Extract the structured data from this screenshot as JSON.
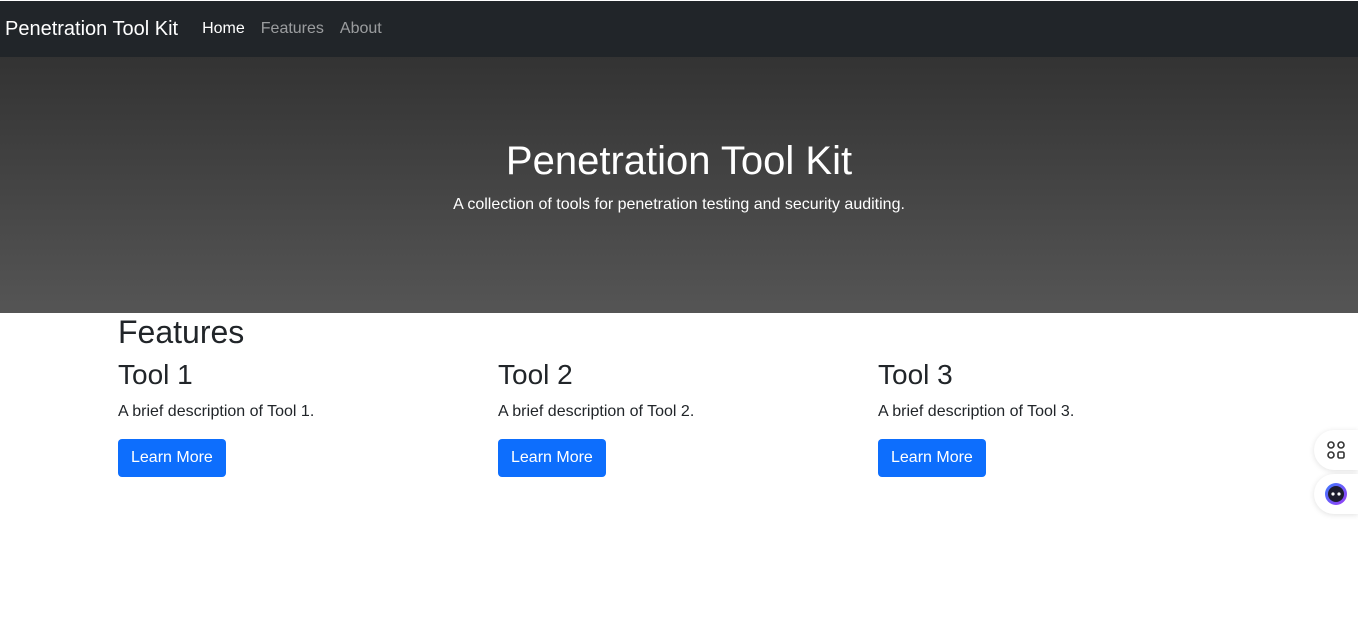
{
  "navbar": {
    "brand": "Penetration Tool Kit",
    "links": [
      {
        "label": "Home"
      },
      {
        "label": "Features"
      },
      {
        "label": "About"
      }
    ]
  },
  "hero": {
    "title": "Penetration Tool Kit",
    "subtitle": "A collection of tools for penetration testing and security auditing."
  },
  "features": {
    "title": "Features",
    "tools": [
      {
        "name": "Tool 1",
        "description": "A brief description of Tool 1.",
        "button": "Learn More"
      },
      {
        "name": "Tool 2",
        "description": "A brief description of Tool 2.",
        "button": "Learn More"
      },
      {
        "name": "Tool 3",
        "description": "A brief description of Tool 3.",
        "button": "Learn More"
      }
    ]
  },
  "side_widgets": {
    "apps_icon": "apps-grid-icon",
    "assistant_icon": "assistant-face-icon"
  },
  "colors": {
    "navbar_bg": "#212529",
    "primary": "#0d6efd",
    "hero_gradient_top": "#333333",
    "hero_gradient_bottom": "#555555",
    "assistant_accent": "#6b3cf5"
  }
}
